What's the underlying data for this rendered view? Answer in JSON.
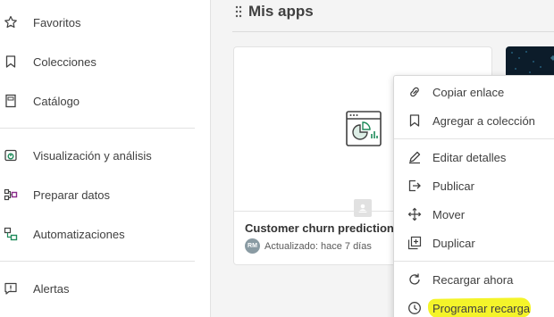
{
  "sidebar": {
    "items": [
      {
        "label": "Favoritos",
        "icon": "star-icon"
      },
      {
        "label": "Colecciones",
        "icon": "bookmark-icon"
      },
      {
        "label": "Catálogo",
        "icon": "catalog-icon"
      },
      {
        "label": "Visualización y análisis",
        "icon": "analytics-icon"
      },
      {
        "label": "Preparar datos",
        "icon": "data-prep-icon"
      },
      {
        "label": "Automatizaciones",
        "icon": "automation-icon"
      },
      {
        "label": "Alertas",
        "icon": "alert-icon"
      }
    ]
  },
  "main": {
    "section_title": "Mis apps",
    "card": {
      "title": "Customer churn predictions",
      "avatar_initials": "RM",
      "updated": "Actualizado: hace 7 días"
    }
  },
  "context_menu": {
    "items": [
      {
        "label": "Copiar enlace",
        "icon": "link-icon"
      },
      {
        "label": "Agregar a colección",
        "icon": "bookmark-icon"
      },
      {
        "label": "Editar detalles",
        "icon": "pencil-icon"
      },
      {
        "label": "Publicar",
        "icon": "publish-icon"
      },
      {
        "label": "Mover",
        "icon": "move-icon"
      },
      {
        "label": "Duplicar",
        "icon": "duplicate-icon"
      },
      {
        "label": "Recargar ahora",
        "icon": "reload-icon"
      },
      {
        "label": "Programar recarga",
        "icon": "clock-icon"
      }
    ],
    "highlighted_item": "Programar recarga",
    "highlight_color": "#f4f42a"
  },
  "colors": {
    "prepare_data_accent": "#8a2b8a",
    "automation_accent": "#1e8a5a",
    "analytics_accent": "#1e8a5a"
  }
}
